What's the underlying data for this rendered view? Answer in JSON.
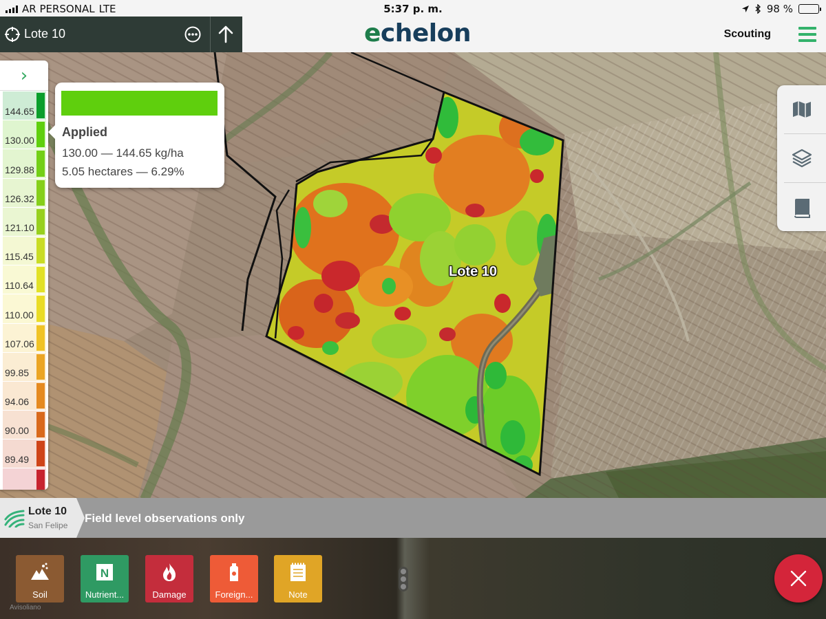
{
  "status_bar": {
    "carrier": "AR PERSONAL",
    "network": "LTE",
    "time": "5:37 p. m.",
    "battery": "98 %",
    "battery_level": 0.98
  },
  "header": {
    "field_title": "Lote 10",
    "logo_e": "e",
    "logo_rest": "chelon",
    "mode_label": "Scouting"
  },
  "map": {
    "field_label": "Lote 10"
  },
  "legend": {
    "toggle_icon": "chevron-right-icon",
    "rows": [
      {
        "value": "144.65",
        "color": "#0a9e2c"
      },
      {
        "value": "130.00",
        "color": "#5fcf0d"
      },
      {
        "value": "129.88",
        "color": "#73cf16"
      },
      {
        "value": "126.32",
        "color": "#86cf1a"
      },
      {
        "value": "121.10",
        "color": "#98d01f"
      },
      {
        "value": "115.45",
        "color": "#c9dc24"
      },
      {
        "value": "110.64",
        "color": "#e2e126"
      },
      {
        "value": "110.00",
        "color": "#eadc26"
      },
      {
        "value": "107.06",
        "color": "#f0c326"
      },
      {
        "value": "99.85",
        "color": "#eba524"
      },
      {
        "value": "94.06",
        "color": "#e58a20"
      },
      {
        "value": "90.00",
        "color": "#d9691c"
      },
      {
        "value": "89.49",
        "color": "#cf4418"
      },
      {
        "value": "",
        "color": "#c7232f"
      }
    ]
  },
  "tooltip": {
    "color": "#5fcf0d",
    "title": "Applied",
    "range": "130.00 — 144.65 kg/ha",
    "area": "5.05 hectares — 6.29%"
  },
  "tools": [
    "map-icon",
    "layers-icon",
    "book-icon"
  ],
  "info_strip": {
    "field_name": "Lote 10",
    "farm_name": "San Felipe",
    "message": "Field level observations only"
  },
  "observations": [
    {
      "label": "Soil",
      "color": "#8b5a32",
      "icon": "soil-icon"
    },
    {
      "label": "Nutrient...",
      "color": "#2f9a63",
      "icon": "nutrient-icon"
    },
    {
      "label": "Damage",
      "color": "#c42d3c",
      "icon": "flame-icon"
    },
    {
      "label": "Foreign...",
      "color": "#ee5b37",
      "icon": "spray-can-icon"
    },
    {
      "label": "Note",
      "color": "#e0a526",
      "icon": "notepad-icon"
    }
  ],
  "credit": "Avisoliano"
}
